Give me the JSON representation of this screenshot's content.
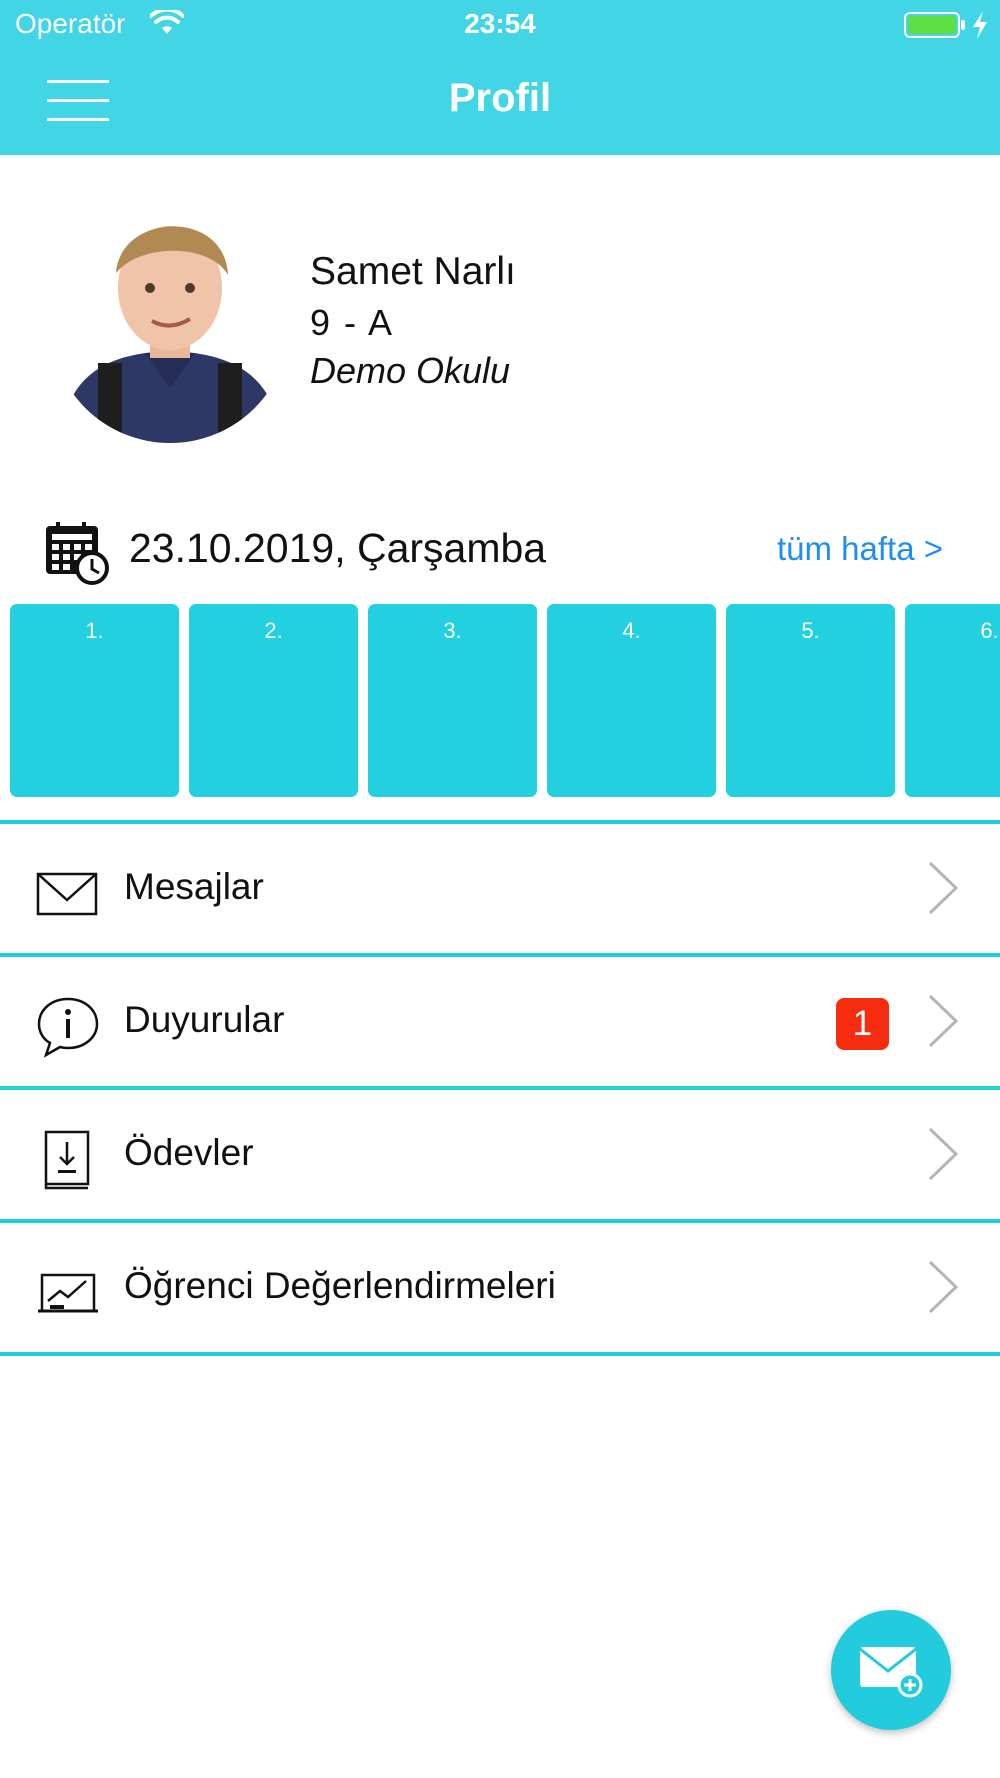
{
  "status_bar": {
    "carrier": "Operatör",
    "time": "23:54"
  },
  "nav": {
    "title": "Profil",
    "menu_icon": "hamburger-menu-icon"
  },
  "profile": {
    "name": "Samet Narlı",
    "class": "9 - A",
    "school": "Demo Okulu"
  },
  "schedule": {
    "date": "23.10.2019, Çarşamba",
    "week_link": "tüm hafta >",
    "lessons": [
      "1.",
      "2.",
      "3.",
      "4.",
      "5.",
      "6."
    ]
  },
  "menu": [
    {
      "label": "Mesajlar",
      "icon": "envelope-icon"
    },
    {
      "label": "Duyurular",
      "icon": "info-bubble-icon",
      "badge": "1"
    },
    {
      "label": "Ödevler",
      "icon": "homework-book-icon"
    },
    {
      "label": "Öğrenci Değerlendirmeleri",
      "icon": "chart-board-icon"
    }
  ],
  "fab": {
    "icon": "new-message-icon"
  },
  "colors": {
    "primary": "#41d5e6",
    "lesson_cell": "#22d0e0",
    "divider": "#22cddc",
    "link": "#1e8ef0",
    "badge": "#f62c10"
  }
}
